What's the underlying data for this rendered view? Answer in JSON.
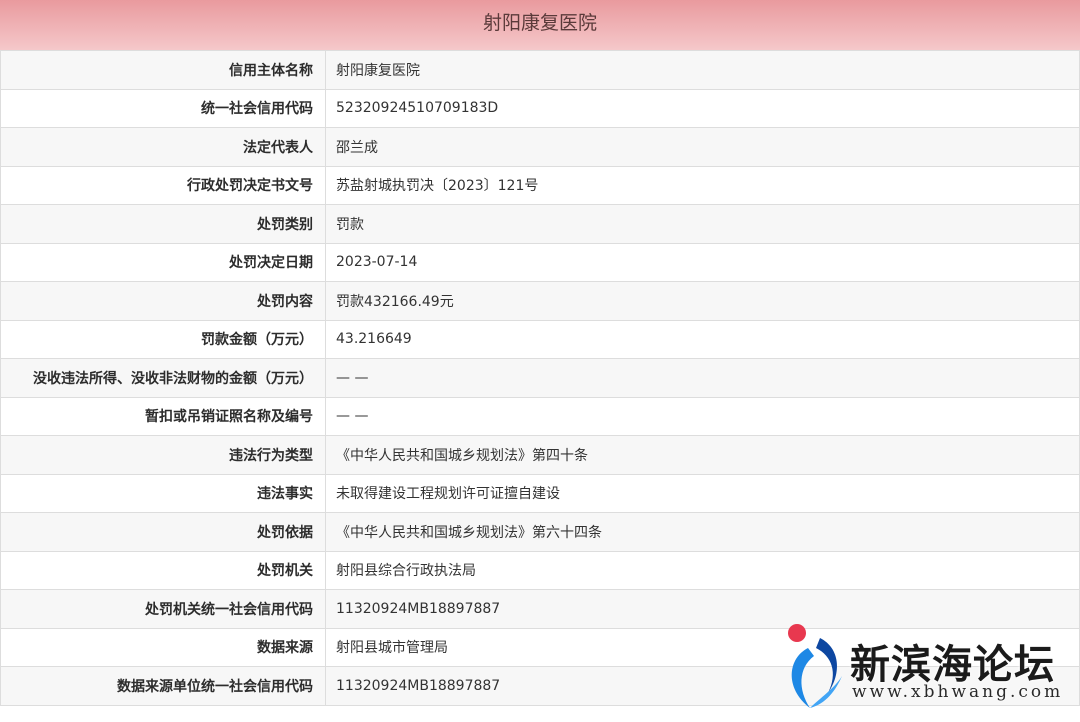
{
  "title": "射阳康复医院",
  "rows": [
    {
      "label": "信用主体名称",
      "value": "射阳康复医院"
    },
    {
      "label": "统一社会信用代码",
      "value": "52320924510709183D"
    },
    {
      "label": "法定代表人",
      "value": "邵兰成"
    },
    {
      "label": "行政处罚决定书文号",
      "value": "苏盐射城执罚决〔2023〕121号"
    },
    {
      "label": "处罚类别",
      "value": "罚款"
    },
    {
      "label": "处罚决定日期",
      "value": "2023-07-14"
    },
    {
      "label": "处罚内容",
      "value": "罚款432166.49元"
    },
    {
      "label": "罚款金额（万元）",
      "value": "43.216649"
    },
    {
      "label": "没收违法所得、没收非法财物的金额（万元）",
      "value": "— —"
    },
    {
      "label": "暂扣或吊销证照名称及编号",
      "value": "— —"
    },
    {
      "label": "违法行为类型",
      "value": "《中华人民共和国城乡规划法》第四十条"
    },
    {
      "label": "违法事实",
      "value": "未取得建设工程规划许可证擅自建设"
    },
    {
      "label": "处罚依据",
      "value": "《中华人民共和国城乡规划法》第六十四条"
    },
    {
      "label": "处罚机关",
      "value": "射阳县综合行政执法局"
    },
    {
      "label": "处罚机关统一社会信用代码",
      "value": "11320924MB18897887"
    },
    {
      "label": "数据来源",
      "value": "射阳县城市管理局"
    },
    {
      "label": "数据来源单位统一社会信用代码",
      "value": "11320924MB18897887"
    }
  ],
  "watermark": {
    "name": "新滨海论坛",
    "url": "www.xbhwang.com",
    "logo_icon": "xbh-logo-icon",
    "colors": {
      "red": "#e8384f",
      "blue": "#1e88e5"
    }
  }
}
